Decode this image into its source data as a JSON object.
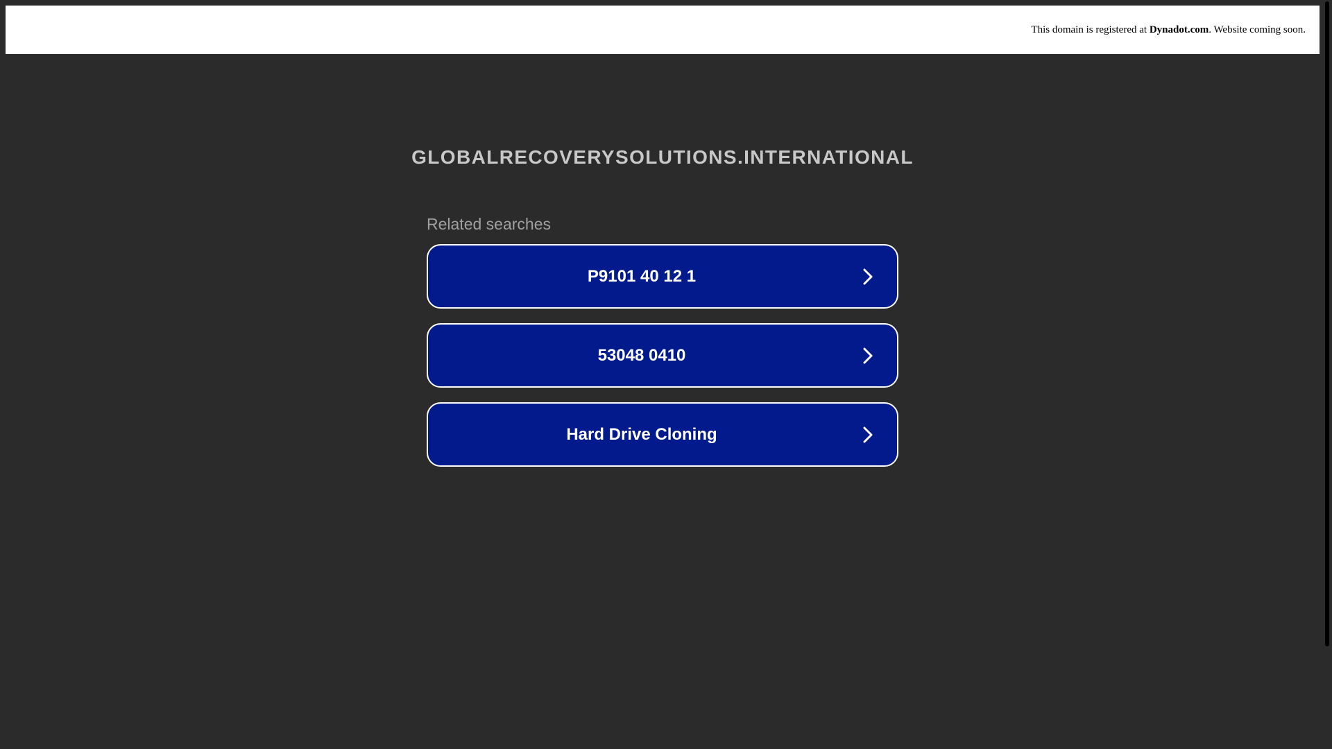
{
  "banner": {
    "prefix": "This domain is registered at ",
    "registrar": "Dynadot.com",
    "suffix": ". Website coming soon."
  },
  "domain_title": "GLOBALRECOVERYSOLUTIONS.INTERNATIONAL",
  "related": {
    "heading": "Related searches",
    "items": [
      {
        "label": "P9101 40 12 1",
        "icon": "chevron-right-icon"
      },
      {
        "label": "53048 0410",
        "icon": "chevron-right-icon"
      },
      {
        "label": "Hard Drive Cloning",
        "icon": "chevron-right-icon"
      }
    ]
  },
  "colors": {
    "background": "#2b2b2b",
    "button": "#031a8c",
    "button_border": "#ffffff",
    "title": "#c8c8c8",
    "heading": "#a0a0a0"
  }
}
